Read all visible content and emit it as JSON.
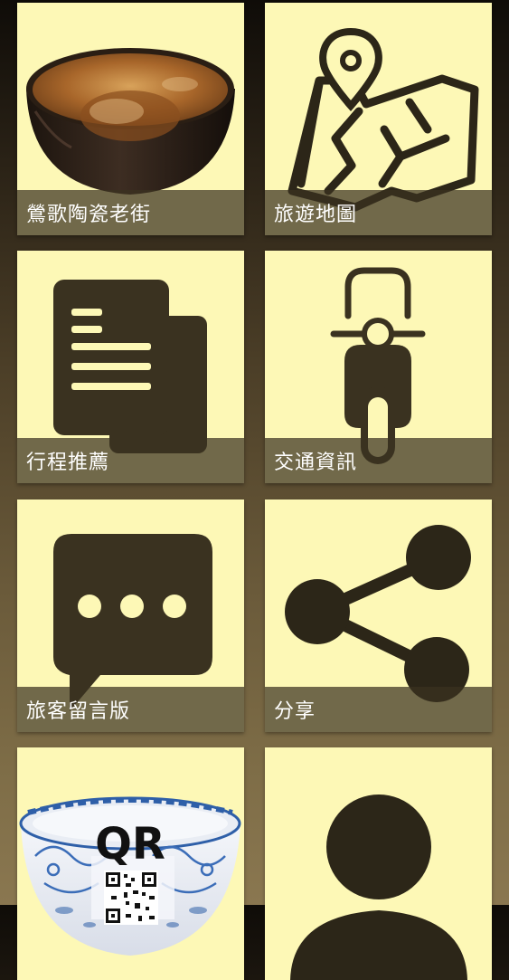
{
  "menu": {
    "items": [
      {
        "label": "鶯歌陶瓷老街",
        "icon": "ceramic-bowl-icon"
      },
      {
        "label": "旅遊地圖",
        "icon": "map-pin-icon"
      },
      {
        "label": "行程推薦",
        "icon": "document-icon"
      },
      {
        "label": "交通資訊",
        "icon": "scooter-icon"
      },
      {
        "label": "旅客留言版",
        "icon": "chat-bubble-icon"
      },
      {
        "label": "分享",
        "icon": "share-icon"
      },
      {
        "label": "",
        "icon": "qr-code-bowl-icon"
      },
      {
        "label": "",
        "icon": "person-icon"
      }
    ]
  },
  "qr_logo_text": "QR",
  "colors": {
    "tile_background": "#fdf8b6",
    "icon_dark": "#3a3220",
    "label_bar": "#3a3220",
    "label_text": "#ffffff"
  }
}
